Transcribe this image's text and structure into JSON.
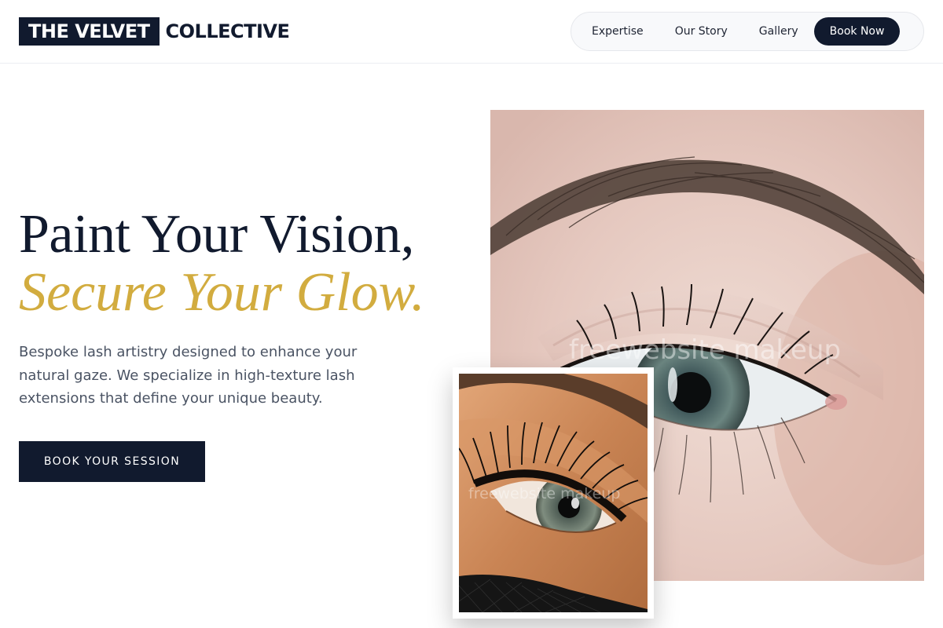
{
  "header": {
    "logo_boxed": "THE VELVET",
    "logo_rest": "COLLECTIVE",
    "nav": [
      {
        "label": "Expertise"
      },
      {
        "label": "Our Story"
      },
      {
        "label": "Gallery"
      }
    ],
    "cta_label": "Book Now"
  },
  "hero": {
    "title_line1": "Paint Your Vision,",
    "title_line2": "Secure Your Glow.",
    "description": "Bespoke lash artistry designed to enhance your natural gaze. We specialize in high-texture lash extensions that define your unique beauty.",
    "button_label": "BOOK YOUR SESSION"
  },
  "images": {
    "big_watermark": "freewebsite makeup",
    "small_watermark": "freewebsite makeup"
  },
  "colors": {
    "navy": "#111a2e",
    "gold": "#d2ac3f",
    "body_text": "#4a5363"
  }
}
